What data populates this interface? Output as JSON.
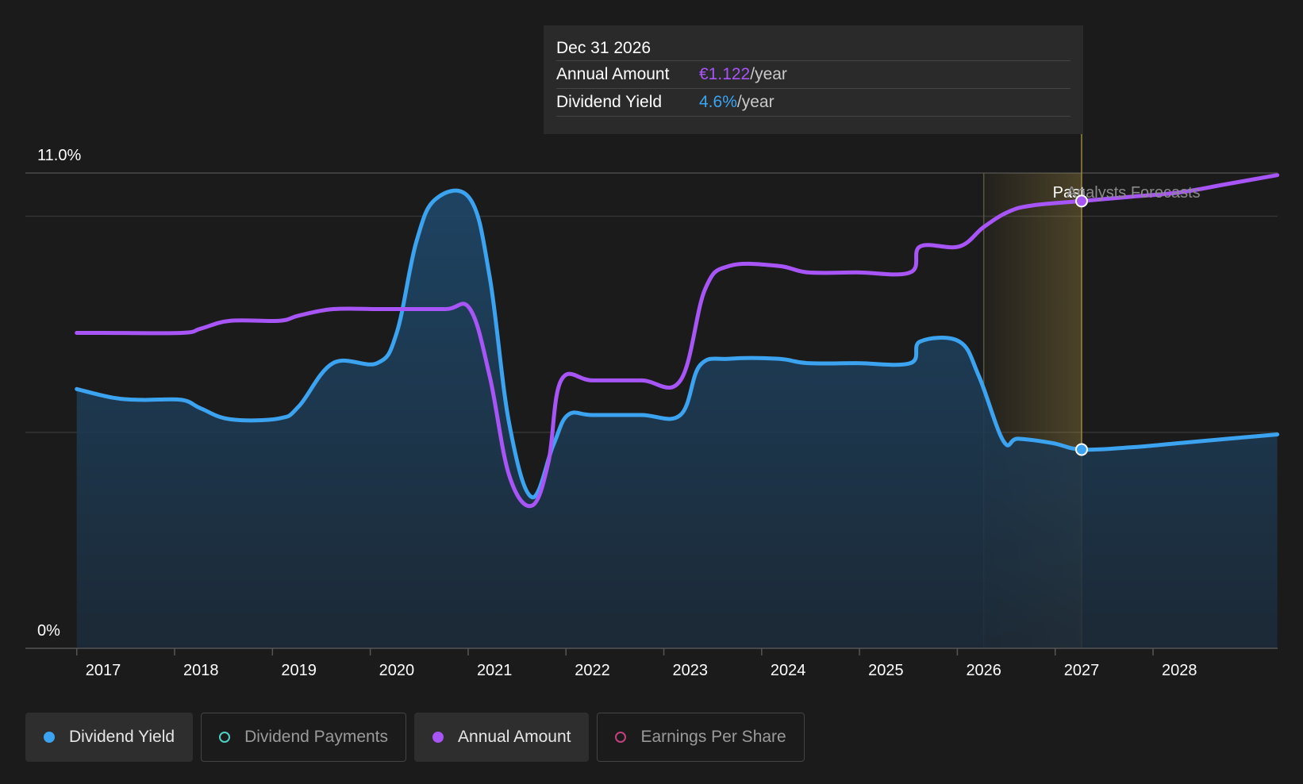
{
  "tooltip": {
    "date": "Dec 31 2026",
    "annual_label": "Annual Amount",
    "annual_value": "€1.122",
    "annual_unit": "/year",
    "yield_label": "Dividend Yield",
    "yield_value": "4.6%",
    "yield_unit": "/year"
  },
  "legend": [
    {
      "label": "Dividend Yield",
      "color": "#3ba3f0",
      "active": true
    },
    {
      "label": "Dividend Payments",
      "color": "#4fd1c5",
      "active": false
    },
    {
      "label": "Annual Amount",
      "color": "#a855f7",
      "active": true
    },
    {
      "label": "Earnings Per Share",
      "color": "#c2417d",
      "active": false
    }
  ],
  "chart_data": {
    "type": "line",
    "y_axis_labels": {
      "top": "11.0%",
      "bottom": "0%"
    },
    "ylim": [
      0,
      11.0
    ],
    "xlim": [
      2016.5,
      2029.0
    ],
    "x_ticks": [
      "2017",
      "2018",
      "2019",
      "2020",
      "2021",
      "2022",
      "2023",
      "2024",
      "2025",
      "2026",
      "2027",
      "2028"
    ],
    "past_label": "Past",
    "forecast_label": "Analysts Forecasts",
    "forecast_start": 2026.0,
    "highlight_x": 2027.0,
    "colors": {
      "yield": "#3ba3f0",
      "annual": "#a855f7",
      "band": "#c8a84a"
    },
    "series": [
      {
        "name": "Dividend Yield",
        "key": "yield",
        "points": [
          [
            2016.73,
            6.0
          ],
          [
            2017.1,
            5.8
          ],
          [
            2017.4,
            5.75
          ],
          [
            2017.8,
            5.75
          ],
          [
            2018.0,
            5.55
          ],
          [
            2018.3,
            5.3
          ],
          [
            2018.8,
            5.32
          ],
          [
            2019.0,
            5.6
          ],
          [
            2019.35,
            6.6
          ],
          [
            2019.8,
            6.6
          ],
          [
            2020.0,
            7.3
          ],
          [
            2020.2,
            9.4
          ],
          [
            2020.4,
            10.4
          ],
          [
            2020.75,
            10.4
          ],
          [
            2020.95,
            8.6
          ],
          [
            2021.15,
            5.2
          ],
          [
            2021.38,
            3.5
          ],
          [
            2021.6,
            4.7
          ],
          [
            2021.75,
            5.4
          ],
          [
            2022.0,
            5.4
          ],
          [
            2022.5,
            5.4
          ],
          [
            2022.9,
            5.4
          ],
          [
            2023.1,
            6.55
          ],
          [
            2023.4,
            6.7
          ],
          [
            2023.9,
            6.7
          ],
          [
            2024.2,
            6.6
          ],
          [
            2024.7,
            6.6
          ],
          [
            2025.25,
            6.6
          ],
          [
            2025.35,
            7.1
          ],
          [
            2025.75,
            7.1
          ],
          [
            2025.95,
            6.3
          ],
          [
            2026.2,
            4.8
          ],
          [
            2026.35,
            4.85
          ],
          [
            2026.7,
            4.75
          ],
          [
            2027.0,
            4.6
          ],
          [
            2027.5,
            4.65
          ],
          [
            2028.0,
            4.75
          ],
          [
            2028.5,
            4.85
          ],
          [
            2029.0,
            4.95
          ]
        ]
      },
      {
        "name": "Annual Amount",
        "key": "annual",
        "points": [
          [
            2016.73,
            7.3
          ],
          [
            2017.0,
            7.3
          ],
          [
            2017.8,
            7.3
          ],
          [
            2018.0,
            7.4
          ],
          [
            2018.3,
            7.58
          ],
          [
            2018.8,
            7.58
          ],
          [
            2019.0,
            7.7
          ],
          [
            2019.35,
            7.85
          ],
          [
            2019.8,
            7.85
          ],
          [
            2020.0,
            7.85
          ],
          [
            2020.5,
            7.85
          ],
          [
            2020.75,
            7.85
          ],
          [
            2020.95,
            6.3
          ],
          [
            2021.15,
            4.0
          ],
          [
            2021.38,
            3.3
          ],
          [
            2021.55,
            4.3
          ],
          [
            2021.68,
            6.2
          ],
          [
            2022.0,
            6.2
          ],
          [
            2022.5,
            6.2
          ],
          [
            2022.9,
            6.2
          ],
          [
            2023.15,
            8.3
          ],
          [
            2023.4,
            8.85
          ],
          [
            2023.9,
            8.85
          ],
          [
            2024.2,
            8.7
          ],
          [
            2024.7,
            8.7
          ],
          [
            2025.25,
            8.7
          ],
          [
            2025.35,
            9.3
          ],
          [
            2025.75,
            9.3
          ],
          [
            2026.0,
            9.75
          ],
          [
            2026.25,
            10.1
          ],
          [
            2026.5,
            10.25
          ],
          [
            2027.0,
            10.35
          ],
          [
            2027.5,
            10.45
          ],
          [
            2028.0,
            10.55
          ],
          [
            2028.5,
            10.75
          ],
          [
            2029.0,
            10.95
          ]
        ]
      }
    ]
  }
}
